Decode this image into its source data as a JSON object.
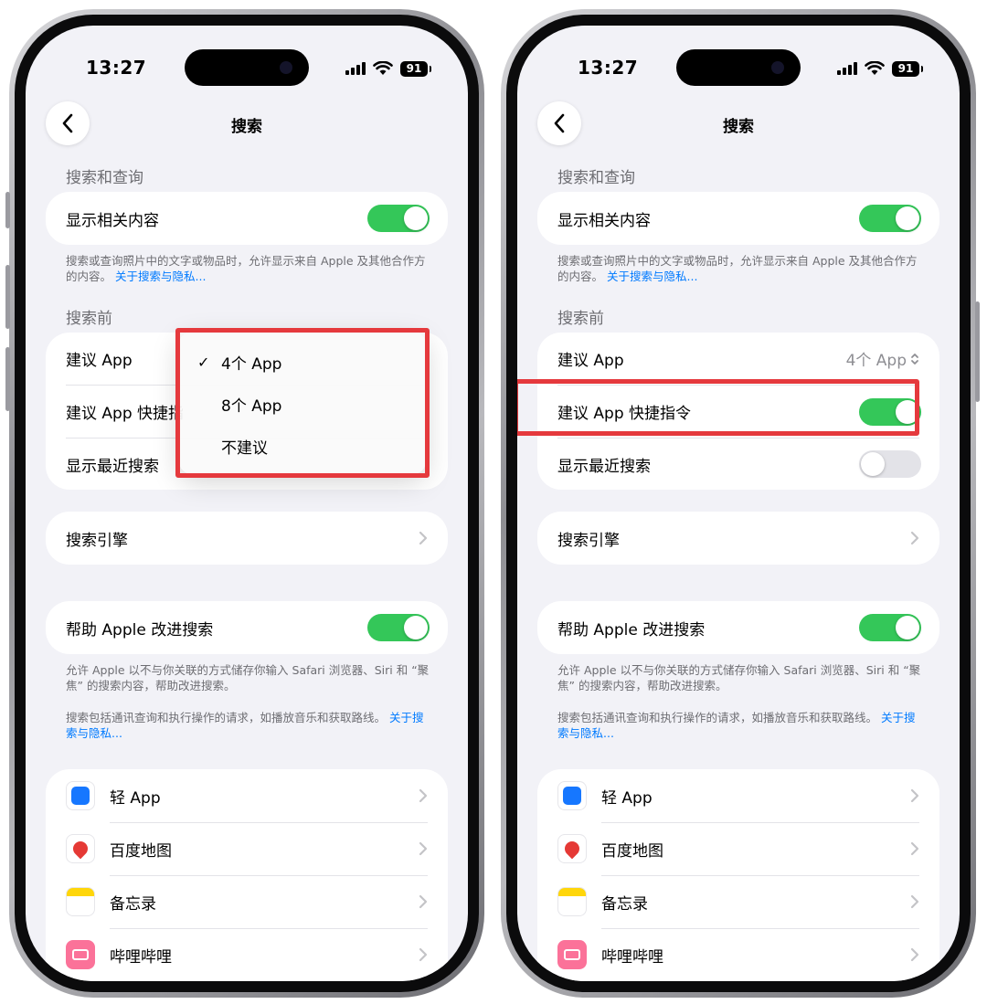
{
  "left": {
    "status": {
      "time": "13:27",
      "battery": "91"
    },
    "nav": {
      "title": "搜索"
    },
    "section_search_lookup": {
      "header": "搜索和查询",
      "show_related": {
        "label": "显示相关内容",
        "on": true
      },
      "footnote": "搜索或查询照片中的文字或物品时，允许显示来自 Apple 及其他合作方的内容。",
      "footnote_link": "关于搜索与隐私..."
    },
    "section_before_search": {
      "header": "搜索前",
      "suggest_app": {
        "label": "建议 App"
      },
      "suggest_shortcuts": {
        "label": "建议 App 快捷指令"
      },
      "show_recent": {
        "label": "显示最近搜索"
      }
    },
    "menu": {
      "items": [
        {
          "label": "4个 App",
          "checked": true
        },
        {
          "label": "8个 App",
          "checked": false
        },
        {
          "label": "不建议",
          "checked": false
        }
      ],
      "check_glyph": "✓"
    },
    "search_engine": {
      "label": "搜索引擎"
    },
    "help_apple": {
      "label": "帮助 Apple 改进搜索",
      "on": true,
      "footnote1": "允许 Apple 以不与你关联的方式储存你输入 Safari 浏览器、Siri 和 “聚焦” 的搜索内容，帮助改进搜索。",
      "footnote2": "搜索包括通讯查询和执行操作的请求，如播放音乐和获取路线。",
      "footnote2_link": "关于搜索与隐私..."
    },
    "apps": [
      {
        "label": "轻 App",
        "icon": "light-app-icon"
      },
      {
        "label": "百度地图",
        "icon": "baidu-map-icon"
      },
      {
        "label": "备忘录",
        "icon": "notes-icon"
      },
      {
        "label": "哔哩哔哩",
        "icon": "bilibili-icon"
      }
    ]
  },
  "right": {
    "status": {
      "time": "13:27",
      "battery": "91"
    },
    "nav": {
      "title": "搜索"
    },
    "section_search_lookup": {
      "header": "搜索和查询",
      "show_related": {
        "label": "显示相关内容",
        "on": true
      },
      "footnote": "搜索或查询照片中的文字或物品时，允许显示来自 Apple 及其他合作方的内容。",
      "footnote_link": "关于搜索与隐私..."
    },
    "section_before_search": {
      "header": "搜索前",
      "suggest_app": {
        "label": "建议 App",
        "value": "4个 App"
      },
      "suggest_shortcuts": {
        "label": "建议 App 快捷指令",
        "on": true
      },
      "show_recent": {
        "label": "显示最近搜索",
        "on": false
      }
    },
    "search_engine": {
      "label": "搜索引擎"
    },
    "help_apple": {
      "label": "帮助 Apple 改进搜索",
      "on": true,
      "footnote1": "允许 Apple 以不与你关联的方式储存你输入 Safari 浏览器、Siri 和 “聚焦” 的搜索内容，帮助改进搜索。",
      "footnote2": "搜索包括通讯查询和执行操作的请求，如播放音乐和获取路线。",
      "footnote2_link": "关于搜索与隐私..."
    },
    "apps": [
      {
        "label": "轻 App",
        "icon": "light-app-icon"
      },
      {
        "label": "百度地图",
        "icon": "baidu-map-icon"
      },
      {
        "label": "备忘录",
        "icon": "notes-icon"
      },
      {
        "label": "哔哩哔哩",
        "icon": "bilibili-icon"
      }
    ]
  },
  "colors": {
    "toggle_on": "#34c759",
    "toggle_off": "#e3e3e8",
    "link": "#007aff",
    "highlight": "#e5393d",
    "background": "#f2f2f7"
  }
}
